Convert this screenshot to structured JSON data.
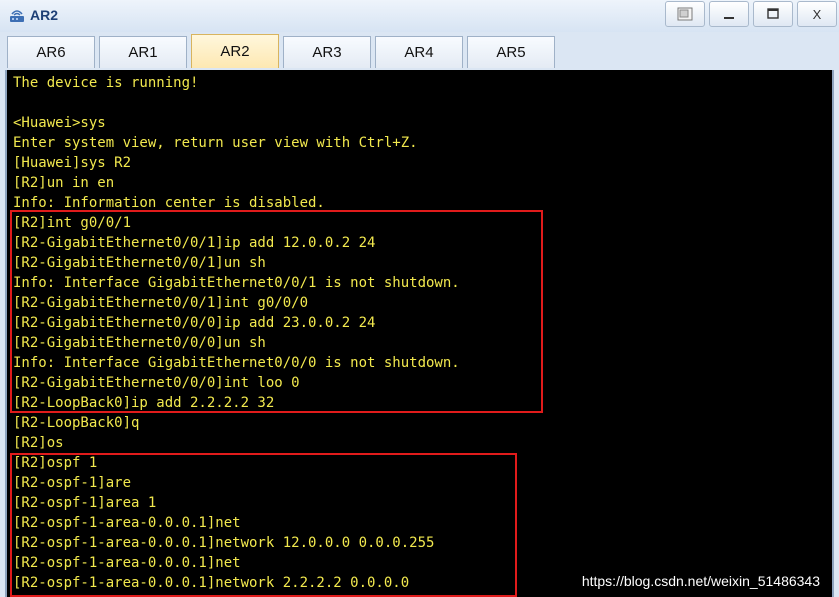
{
  "window": {
    "title": "AR2",
    "icons": {
      "app": "router-icon",
      "restore": "restore-icon",
      "minimize": "minimize-icon",
      "maximize": "maximize-icon",
      "close": "close-icon"
    },
    "close_label": "X"
  },
  "tabs": [
    {
      "label": "AR6"
    },
    {
      "label": "AR1"
    },
    {
      "label": "AR2",
      "active": true
    },
    {
      "label": "AR3"
    },
    {
      "label": "AR4"
    },
    {
      "label": "AR5"
    }
  ],
  "console": {
    "text_color": "#f2e94e",
    "highlight_color": "#e01b1b",
    "lines": [
      "The device is running!",
      "",
      "<Huawei>sys",
      "Enter system view, return user view with Ctrl+Z.",
      "[Huawei]sys R2",
      "[R2]un in en",
      "Info: Information center is disabled.",
      "[R2]int g0/0/1",
      "[R2-GigabitEthernet0/0/1]ip add 12.0.0.2 24",
      "[R2-GigabitEthernet0/0/1]un sh",
      "Info: Interface GigabitEthernet0/0/1 is not shutdown.",
      "[R2-GigabitEthernet0/0/1]int g0/0/0",
      "[R2-GigabitEthernet0/0/0]ip add 23.0.0.2 24",
      "[R2-GigabitEthernet0/0/0]un sh",
      "Info: Interface GigabitEthernet0/0/0 is not shutdown.",
      "[R2-GigabitEthernet0/0/0]int loo 0",
      "[R2-LoopBack0]ip add 2.2.2.2 32",
      "[R2-LoopBack0]q",
      "[R2]os",
      "[R2]ospf 1",
      "[R2-ospf-1]are",
      "[R2-ospf-1]area 1",
      "[R2-ospf-1-area-0.0.0.1]net",
      "[R2-ospf-1-area-0.0.0.1]network 12.0.0.0 0.0.0.255",
      "[R2-ospf-1-area-0.0.0.1]net",
      "[R2-ospf-1-area-0.0.0.1]network 2.2.2.2 0.0.0.0"
    ]
  },
  "watermark": "https://blog.csdn.net/weixin_51486343"
}
